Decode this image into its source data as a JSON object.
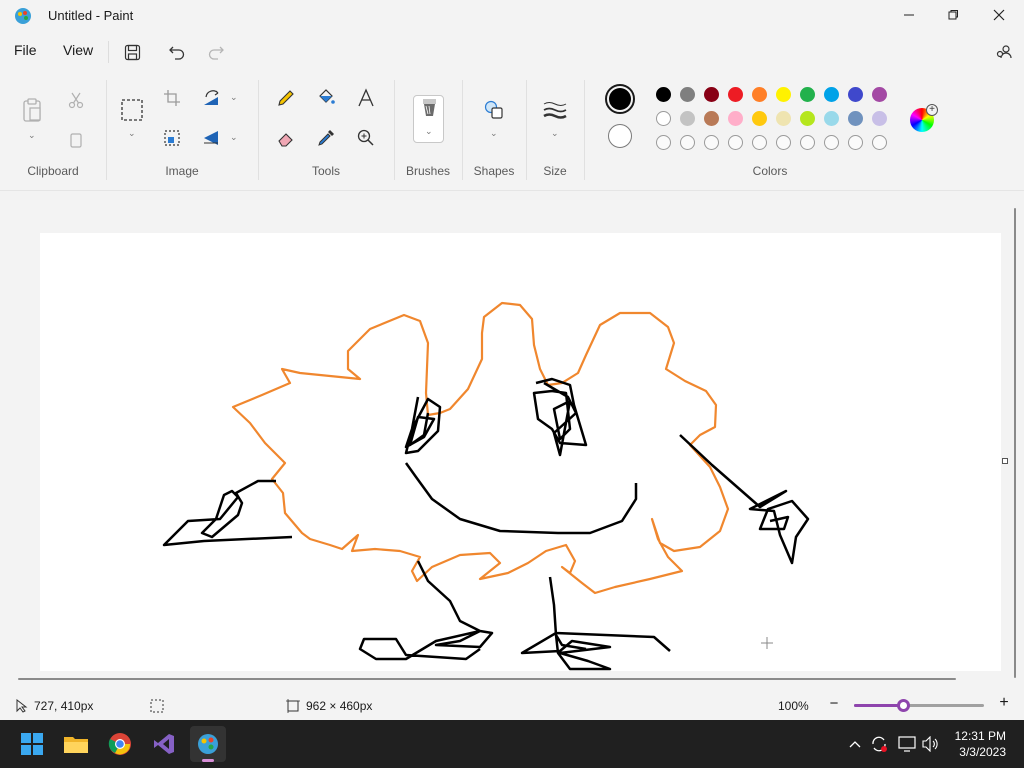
{
  "window": {
    "title": "Untitled - Paint",
    "minimize_icon": "minimize-icon",
    "maximize_icon": "maximize-icon",
    "close_icon": "close-icon"
  },
  "menu": {
    "file": "File",
    "view": "View",
    "save_icon": "save-icon",
    "undo_icon": "undo-icon",
    "redo_icon": "redo-icon",
    "settings_icon": "account-settings-icon"
  },
  "ribbon": {
    "clipboard": "Clipboard",
    "image": "Image",
    "tools": "Tools",
    "brushes": "Brushes",
    "shapes": "Shapes",
    "size": "Size",
    "colors": "Colors"
  },
  "colors": {
    "primary": "#000000",
    "secondary": "#ffffff",
    "row1": [
      "#000000",
      "#7f7f7f",
      "#880015",
      "#ed1c24",
      "#ff7f27",
      "#fff200",
      "#22b14c",
      "#00a2e8",
      "#3f48cc",
      "#a349a4"
    ],
    "row2": [
      "#ffffff",
      "#c3c3c3",
      "#b97a57",
      "#ffaec9",
      "#ffc90e",
      "#efe4b0",
      "#b5e61d",
      "#99d9ea",
      "#7092be",
      "#c8bfe7"
    ],
    "row3_count": 10,
    "stroke_orange": "#f0872e",
    "stroke_black": "#000000",
    "accent": "#8e44ad"
  },
  "status": {
    "cursor_position": "727, 410px",
    "canvas_size": "962 × 460px",
    "zoom_level": "100%",
    "zoom_fraction": 0.38
  },
  "taskbar": {
    "time": "12:31 PM",
    "date": "3/3/2023",
    "apps": [
      "windows-start-icon",
      "file-explorer-icon",
      "chrome-icon",
      "visual-studio-icon",
      "paint-icon"
    ]
  }
}
